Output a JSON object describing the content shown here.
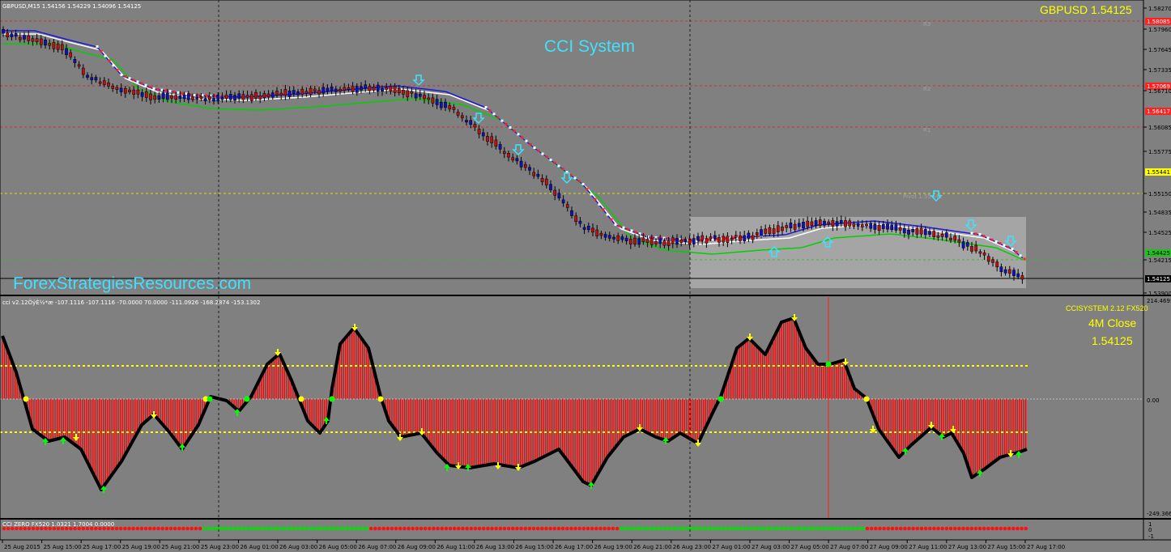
{
  "symbol_bar": "GBPUSD,M15  1.54156 1.54229 1.54096 1.54125",
  "price_label": "GBPUSD  1.54125",
  "watermark_title": "CCI System",
  "watermark_site": "ForexStrategiesResources.com",
  "indicator1_header": "cci v2.12ÖýÈ½*æ -107.1116 -107.1116 -70.0000 70.0000 -111.0926 -168.2874 -153.1302",
  "indicator1_name": "CCISYSTEM 2.12 FX520",
  "indicator1_close_label": "4M Close",
  "indicator1_close_value": "1.54125",
  "indicator2_header": "CCI ZERO FX520 1.0321 1.7004 0.0000",
  "pivot_labels": [
    "R3",
    "R2",
    "R1",
    "Pivot 1.55441",
    "S1"
  ],
  "price_axis": [
    {
      "text": "1.58270",
      "kind": "normal"
    },
    {
      "text": "1.58085",
      "kind": "red"
    },
    {
      "text": "1.57960",
      "kind": "normal"
    },
    {
      "text": "1.57645",
      "kind": "normal"
    },
    {
      "text": "1.57335",
      "kind": "normal"
    },
    {
      "text": "1.57069",
      "kind": "red"
    },
    {
      "text": "1.56710",
      "kind": "normal"
    },
    {
      "text": "1.56417",
      "kind": "red"
    },
    {
      "text": "1.56085",
      "kind": "normal"
    },
    {
      "text": "1.55775",
      "kind": "normal"
    },
    {
      "text": "1.55441",
      "kind": "yellow"
    },
    {
      "text": "1.55150",
      "kind": "normal"
    },
    {
      "text": "1.54835",
      "kind": "normal"
    },
    {
      "text": "1.54525",
      "kind": "normal"
    },
    {
      "text": "1.54425",
      "kind": "green"
    },
    {
      "text": "1.54215",
      "kind": "normal"
    },
    {
      "text": "1.54125",
      "kind": "current"
    },
    {
      "text": "1.53900",
      "kind": "normal"
    }
  ],
  "cci_axis": [
    "214.4695",
    "0.00",
    "-249.3663"
  ],
  "zero_axis": [
    "1",
    "0",
    "-1"
  ],
  "time_axis": [
    "25 Aug 2015",
    "25 Aug 15:00",
    "25 Aug 17:00",
    "25 Aug 19:00",
    "25 Aug 21:00",
    "25 Aug 23:00",
    "26 Aug 01:00",
    "26 Aug 03:00",
    "26 Aug 05:00",
    "26 Aug 07:00",
    "26 Aug 09:00",
    "26 Aug 11:00",
    "26 Aug 13:00",
    "26 Aug 15:00",
    "26 Aug 17:00",
    "26 Aug 19:00",
    "26 Aug 21:00",
    "26 Aug 23:00",
    "27 Aug 01:00",
    "27 Aug 03:00",
    "27 Aug 05:00",
    "27 Aug 07:00",
    "27 Aug 09:00",
    "27 Aug 11:00",
    "27 Aug 13:00",
    "27 Aug 15:00",
    "27 Aug 17:00"
  ],
  "colors": {
    "background": "#808080",
    "bull": "#1010c0",
    "bear": "#c01010",
    "ma_fast": "#1a1ad8",
    "ma_mid": "#ffffff",
    "ma_slow": "#00d000",
    "hist": "#ff0000",
    "cci_line": "#000000",
    "arrow_up": "#00ff00",
    "arrow_down": "#ffff00",
    "signal_cyan": "#40e0ff"
  },
  "chart_data": {
    "type": "line",
    "series": [
      {
        "name": "GBPUSD,M15",
        "values": [
          1.5795,
          1.5785,
          1.5775,
          1.572,
          1.57,
          1.5698,
          1.5695,
          1.5698,
          1.5705,
          1.57,
          1.569,
          1.565,
          1.56,
          1.556,
          1.552,
          1.549,
          1.5485,
          1.549,
          1.5505,
          1.551,
          1.5505,
          1.55,
          1.5495,
          1.547,
          1.5455,
          1.5415
        ]
      },
      {
        "name": "CCISYSTEM 2.12 FX520",
        "values": [
          140,
          -60,
          -70,
          -180,
          -30,
          -90,
          20,
          -60,
          50,
          -60,
          130,
          -60,
          200,
          -70,
          -110,
          -100,
          -115,
          -40,
          -200,
          -50,
          -20,
          -80,
          120,
          250,
          90,
          -50,
          -90,
          -40,
          -120,
          -90,
          -80
        ]
      }
    ],
    "cci_levels": [
      -70,
      0,
      70
    ]
  }
}
